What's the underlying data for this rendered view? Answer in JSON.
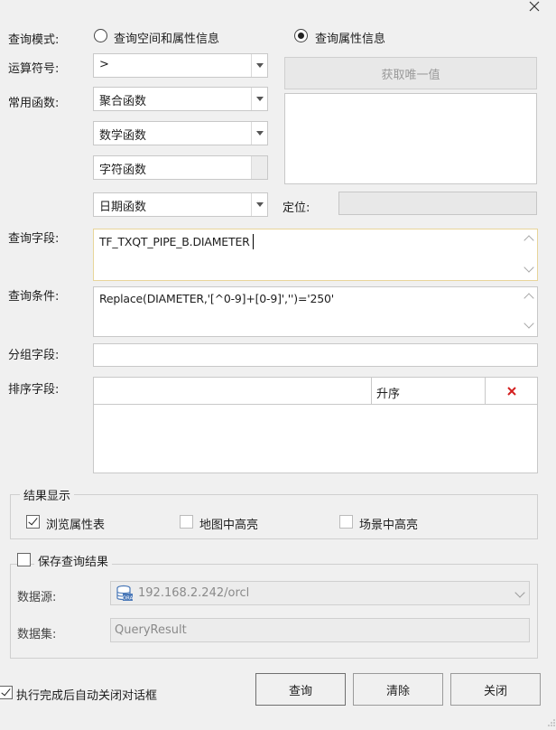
{
  "dialog": {
    "close_icon": "close-icon"
  },
  "query_mode": {
    "label": "查询模式:",
    "option_spatial": "查询空间和属性信息",
    "option_attribute": "查询属性信息",
    "selected": "查询属性信息"
  },
  "operator": {
    "label": "运算符号:",
    "value": ">"
  },
  "functions": {
    "label": "常用函数:",
    "aggregate": "聚合函数",
    "math": "数学函数",
    "string": "字符函数",
    "date": "日期函数"
  },
  "unique_values": {
    "button_label": "获取唯一值",
    "locate_label": "定位:",
    "locate_value": ""
  },
  "query_field": {
    "label": "查询字段:",
    "value": "TF_TXQT_PIPE_B.DIAMETER"
  },
  "query_condition": {
    "label": "查询条件:",
    "value": "Replace(DIAMETER,'[^0-9]+[0-9]','')='250'"
  },
  "group_field": {
    "label": "分组字段:",
    "value": ""
  },
  "sort_field": {
    "label": "排序字段:",
    "order_value": "升序",
    "delete_icon": "delete-x-icon"
  },
  "result_display": {
    "legend": "结果显示",
    "browse_table": "浏览属性表",
    "browse_table_checked": true,
    "map_highlight": "地图中高亮",
    "map_highlight_checked": false,
    "scene_highlight": "场景中高亮",
    "scene_highlight_checked": false
  },
  "save_result": {
    "label": "保存查询结果",
    "checked": false,
    "datasource_label": "数据源:",
    "datasource_value": "192.168.2.242/orcl",
    "dataset_label": "数据集:",
    "dataset_value": "QueryResult"
  },
  "footer": {
    "auto_close_label": "执行完成后自动关闭对话框",
    "auto_close_checked": true,
    "query_button": "查询",
    "clear_button": "清除",
    "close_button": "关闭"
  }
}
